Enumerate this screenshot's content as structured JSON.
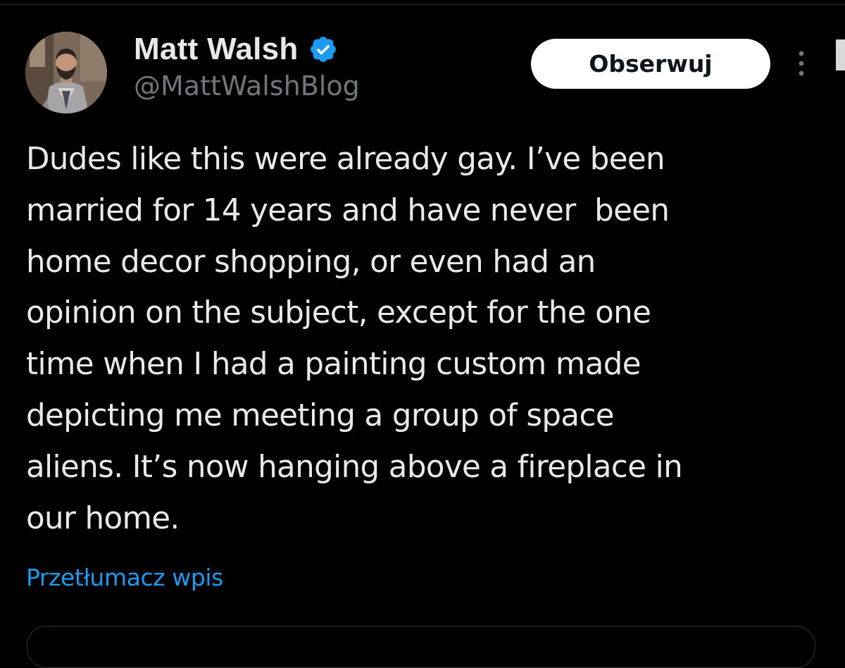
{
  "tweet": {
    "author": {
      "display_name": "Matt Walsh",
      "handle": "@MattWalshBlog",
      "verified_icon": "verified-badge-icon",
      "verified_color": "#1d9bf0"
    },
    "follow_button_label": "Obserwuj",
    "more_icon": "more-vertical-icon",
    "text": "Dudes like this were already gay. I’ve been\nmarried for 14 years and have never  been\nhome decor shopping, or even had an\nopinion on the subject, except for the one\ntime when I had a painting custom made\ndepicting me meeting a group of space\naliens. It’s now hanging above a fireplace in\nour home.",
    "translate_label": "Przetłumacz wpis"
  },
  "colors": {
    "background": "#000000",
    "text_primary": "#e7e9ea",
    "text_secondary": "#71767b",
    "link": "#1d9bf0",
    "button_bg": "#ffffff",
    "button_text": "#0f1419",
    "border": "#2f3336"
  }
}
